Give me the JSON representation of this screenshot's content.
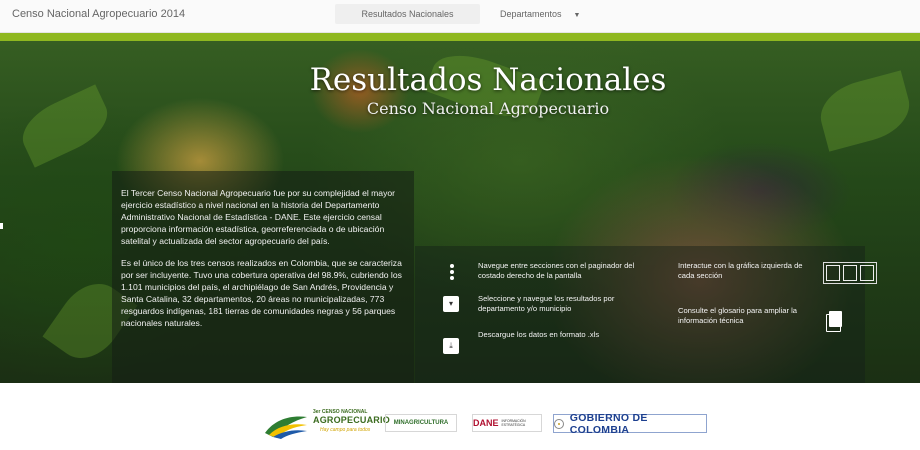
{
  "header": {
    "brand": "Censo Nacional Agropecuario 2014",
    "nav_results": "Resultados Nacionales",
    "nav_departments": "Departamentos"
  },
  "hero": {
    "title": "Resultados Nacionales",
    "subtitle": "Censo Nacional Agropecuario",
    "paragraphs": [
      "El Tercer Censo Nacional Agropecuario fue por su complejidad el mayor ejercicio estadístico a nivel nacional en la historia del Departamento Administrativo Nacional de Estadística - DANE. Este ejercicio censal proporciona información estadística, georreferenciada o de ubicación satelital y actualizada del sector agropecuario del país.",
      "Es el único de los tres censos realizados en Colombia, que se caracteriza por ser incluyente. Tuvo una cobertura operativa del 98.9%, cubriendo los 1.101 municipios del país, el archipiélago de San Andrés, Providencia y Santa Catalina, 32 departamentos, 20 áreas no municipalizadas, 773 resguardos indígenas, 181 tierras de comunidades negras y 56 parques nacionales naturales."
    ]
  },
  "guide": {
    "navigate": "Navegue entre secciones con el paginador del costado derecho de la pantalla",
    "select": "Seleccione y navegue los resultados por departamento y/o municipio",
    "download": "Descargue los datos en formato .xls",
    "interact": "Interactue con la gráfica izquierda de cada sección",
    "glossary": "Consulte el glosario para ampliar la información técnica"
  },
  "icons": {
    "select": "▾",
    "download": "⤓"
  },
  "footer": {
    "agro_line1": "3er CENSO NACIONAL",
    "agro_line2": "AGROPECUARIO",
    "agro_tagline": "Hay campo para todos",
    "minagricultura": "MINAGRICULTURA",
    "dane": "DANE",
    "dane_sub": "INFORMACIÓN ESTRATÉGICA",
    "gobierno": "GOBIERNO DE COLOMBIA"
  },
  "colors": {
    "accent_green": "#8fb820",
    "accent_yellow": "#c6d40b",
    "gob_blue": "#1c3f8f",
    "dane_red": "#b01030"
  }
}
